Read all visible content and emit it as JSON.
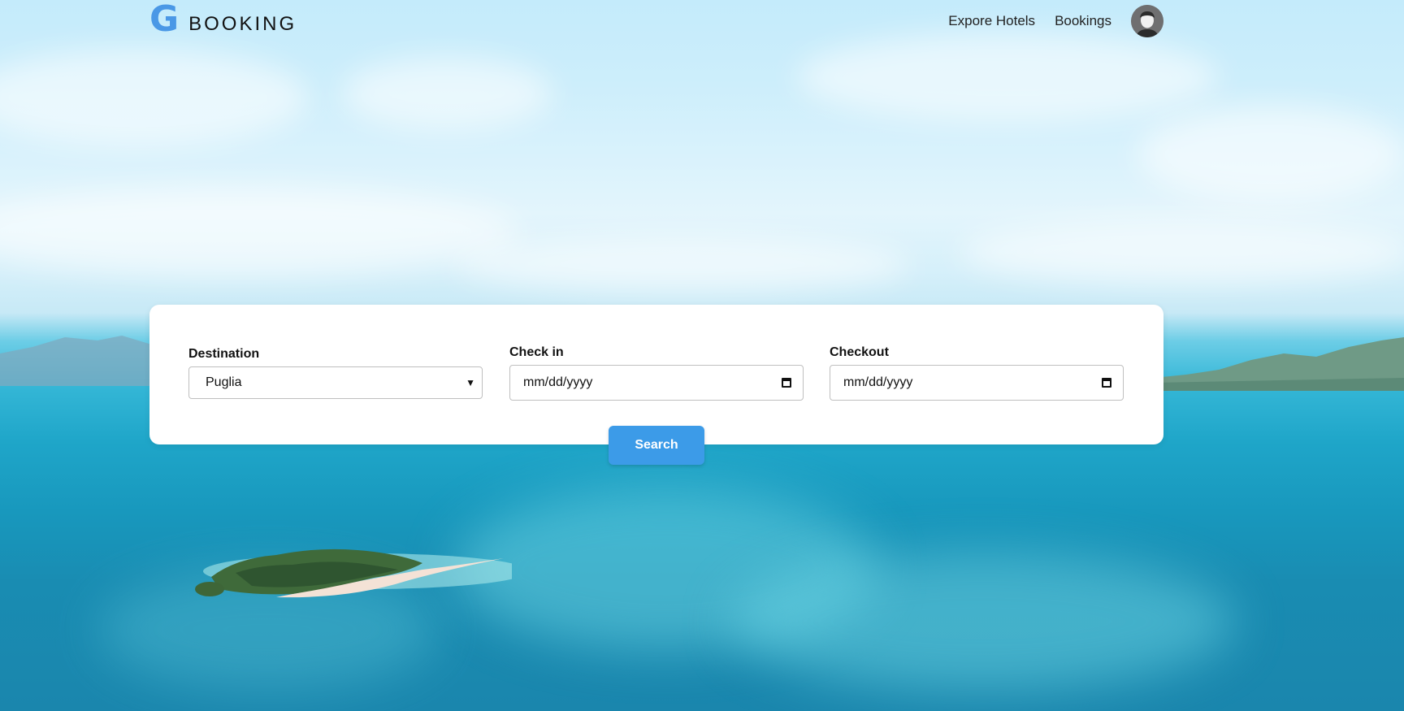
{
  "brand": {
    "logo_letter": "G",
    "name": "BOOKING",
    "accent_color": "#4a98e6"
  },
  "nav": {
    "explore_label": "Expore Hotels",
    "bookings_label": "Bookings",
    "avatar_icon": "user-avatar-icon"
  },
  "search": {
    "destination": {
      "label": "Destination",
      "selected": "Puglia"
    },
    "check_in": {
      "label": "Check in",
      "placeholder": "mm/dd/yyyy"
    },
    "checkout": {
      "label": "Checkout",
      "placeholder": "mm/dd/yyyy"
    },
    "button_label": "Search",
    "button_color": "#3c9be8"
  }
}
